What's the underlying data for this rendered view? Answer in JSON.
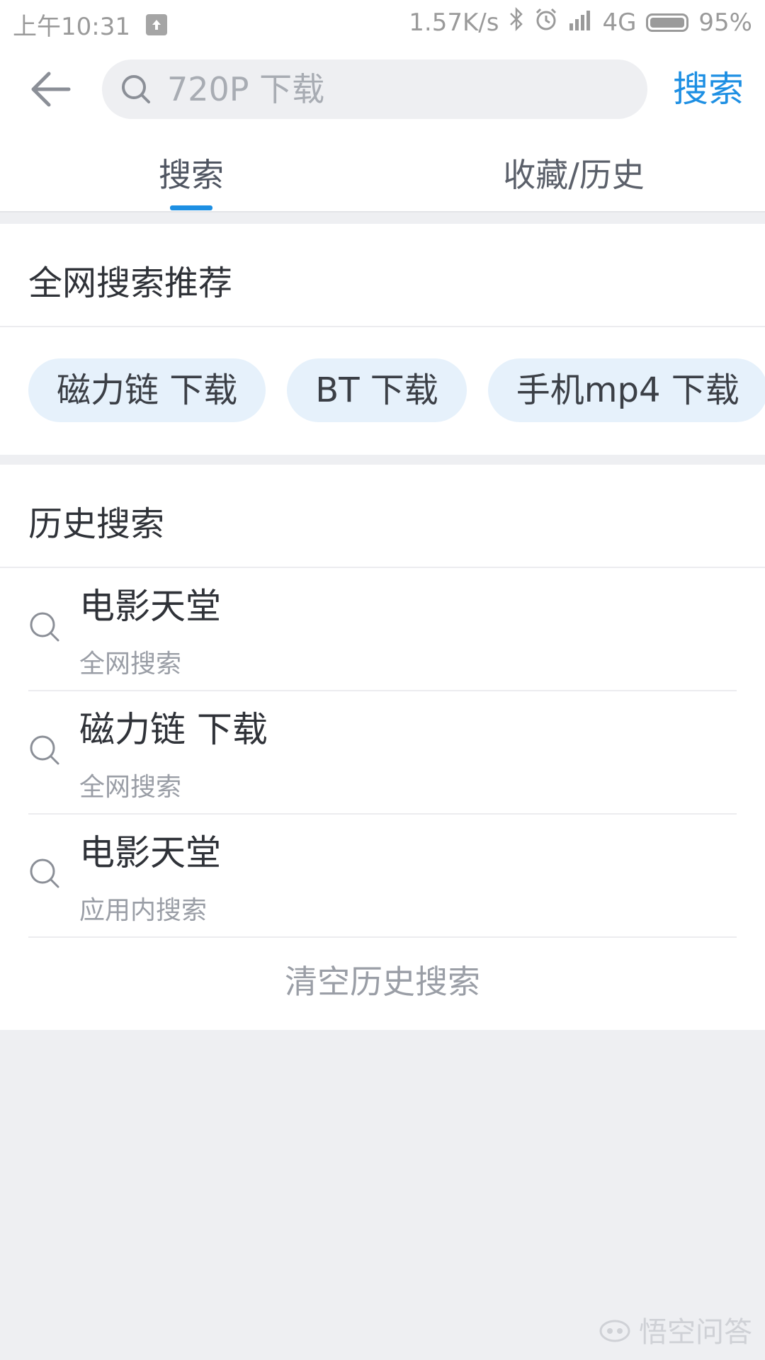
{
  "status_bar": {
    "time": "上午10:31",
    "net_speed": "1.57K/s",
    "network": "4G",
    "battery": "95%"
  },
  "header": {
    "search_placeholder": "720P 下载",
    "search_button": "搜索"
  },
  "tabs": [
    {
      "label": "搜索",
      "active": true
    },
    {
      "label": "收藏/历史",
      "active": false
    }
  ],
  "recommend": {
    "title": "全网搜索推荐",
    "chips": [
      "磁力链 下载",
      "BT 下载",
      "手机mp4 下载"
    ]
  },
  "history": {
    "title": "历史搜索",
    "items": [
      {
        "title": "电影天堂",
        "subtitle": "全网搜索"
      },
      {
        "title": "磁力链 下载",
        "subtitle": "全网搜索"
      },
      {
        "title": "电影天堂",
        "subtitle": "应用内搜索"
      }
    ],
    "clear_label": "清空历史搜索"
  },
  "watermark": "悟空问答",
  "colors": {
    "accent": "#1d8fe3",
    "chip_bg": "#e6f1fb",
    "page_bg": "#eeeff2"
  }
}
